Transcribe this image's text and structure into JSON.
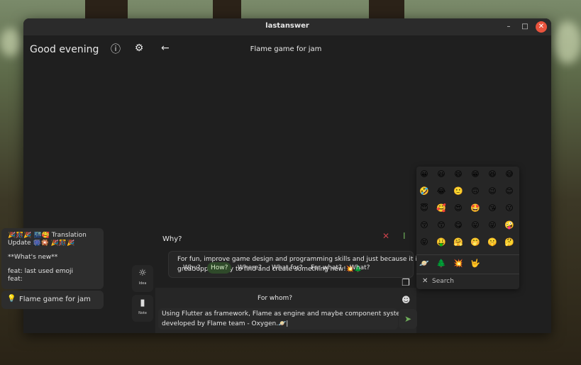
{
  "window": {
    "title": "lastanswer"
  },
  "sidebar": {
    "greeting": "Good evening",
    "note_lines": [
      "🎉🎊🎉  🌃🥰 Translation",
      "Update 🎆🎇  🎉🎊🎉",
      "",
      "**What's new**",
      "",
      "feat: last used emoji",
      "feat:"
    ],
    "bulb_item": "Flame game for jam"
  },
  "rail": {
    "ideas": "Idea",
    "note": "Note"
  },
  "main": {
    "title": "Flame game for jam",
    "question": "Why?",
    "answer_lines": [
      "For fun, improve game design and programming skills and just because it is",
      "great opportunity to find and create something new!💥🌲"
    ],
    "chips": [
      "Why?",
      "How?",
      "Where?",
      "What for?",
      "For what?",
      "What?"
    ],
    "active_chip": "How?",
    "whom": "For whom?",
    "input_lines": [
      "Using Flutter as framework, Flame as engine and maybe component system",
      "developed by Flame team - Oxygen.🪐|"
    ]
  },
  "emoji_picker": {
    "rows": [
      [
        "😀",
        "😃",
        "😄",
        "😁",
        "😆",
        "😅"
      ],
      [
        "🤣",
        "😂",
        "🙂",
        "🙃",
        "😉",
        "😊"
      ],
      [
        "😇",
        "🥰",
        "😍",
        "🤩",
        "😘",
        "😗"
      ],
      [
        "😚",
        "😙",
        "😋",
        "😛",
        "😜",
        "🤪"
      ],
      [
        "😝",
        "🤑",
        "🤗",
        "🤭",
        "🤫",
        "🤔"
      ]
    ],
    "recent": [
      "🪐",
      "🌲",
      "💥",
      "🤟"
    ],
    "search_placeholder": "Search"
  }
}
